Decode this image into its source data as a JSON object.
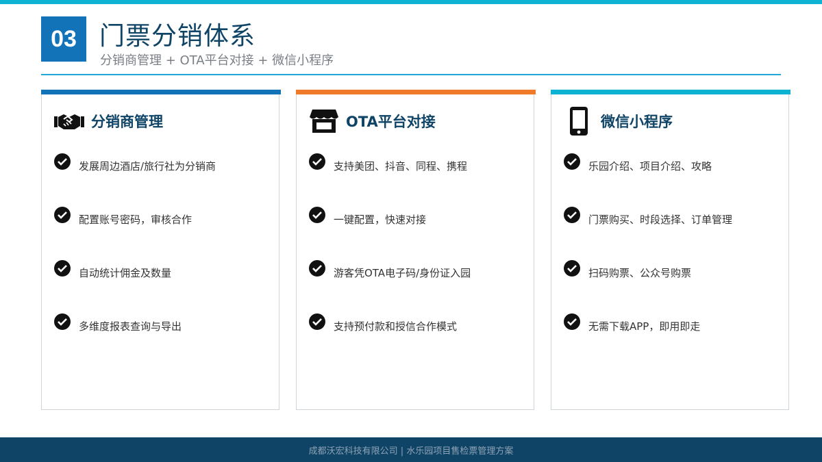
{
  "header": {
    "number": "03",
    "title": "门票分销体系",
    "subtitle": "分销商管理 + OTA平台对接 + 微信小程序"
  },
  "cards": [
    {
      "title": "分销商管理",
      "icon": "handshake-icon",
      "accent": "#1273b8",
      "items": [
        "发展周边酒店/旅行社为分销商",
        "配置账号密码，审核合作",
        "自动统计佣金及数量",
        "多维度报表查询与导出"
      ]
    },
    {
      "title": "OTA平台对接",
      "icon": "store-icon",
      "accent": "#ef7a2a",
      "items": [
        "支持美团、抖音、同程、携程",
        "一键配置，快速对接",
        "游客凭OTA电子码/身份证入园",
        "支持预付款和授信合作模式"
      ]
    },
    {
      "title": "微信小程序",
      "icon": "smartphone-icon",
      "accent": "#0eb3d4",
      "items": [
        "乐园介绍、项目介绍、攻略",
        "门票购买、时段选择、订单管理",
        "扫码购票、公众号购票",
        "无需下载APP，即用即走"
      ]
    }
  ],
  "footer": {
    "text": "成都沃宏科技有限公司 | 水乐园项目售检票管理方案"
  }
}
